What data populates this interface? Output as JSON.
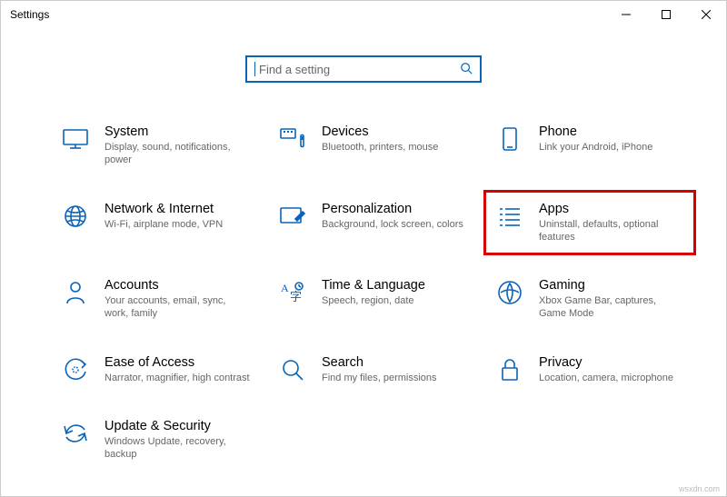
{
  "window": {
    "title": "Settings"
  },
  "search": {
    "placeholder": "Find a setting"
  },
  "tiles": {
    "system": {
      "title": "System",
      "desc": "Display, sound, notifications, power"
    },
    "devices": {
      "title": "Devices",
      "desc": "Bluetooth, printers, mouse"
    },
    "phone": {
      "title": "Phone",
      "desc": "Link your Android, iPhone"
    },
    "network": {
      "title": "Network & Internet",
      "desc": "Wi-Fi, airplane mode, VPN"
    },
    "personalization": {
      "title": "Personalization",
      "desc": "Background, lock screen, colors"
    },
    "apps": {
      "title": "Apps",
      "desc": "Uninstall, defaults, optional features"
    },
    "accounts": {
      "title": "Accounts",
      "desc": "Your accounts, email, sync, work, family"
    },
    "time": {
      "title": "Time & Language",
      "desc": "Speech, region, date"
    },
    "gaming": {
      "title": "Gaming",
      "desc": "Xbox Game Bar, captures, Game Mode"
    },
    "ease": {
      "title": "Ease of Access",
      "desc": "Narrator, magnifier, high contrast"
    },
    "search_tile": {
      "title": "Search",
      "desc": "Find my files, permissions"
    },
    "privacy": {
      "title": "Privacy",
      "desc": "Location, camera, microphone"
    },
    "update": {
      "title": "Update & Security",
      "desc": "Windows Update, recovery, backup"
    }
  },
  "watermark": "wsxdn.com"
}
